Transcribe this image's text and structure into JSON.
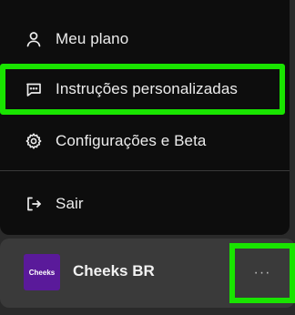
{
  "menu": {
    "items": [
      {
        "label": "Meu plano",
        "icon": "user-icon"
      },
      {
        "label": "Instruções personalizadas",
        "icon": "message-square-icon"
      },
      {
        "label": "Configurações e Beta",
        "icon": "gear-icon"
      },
      {
        "label": "Sair",
        "icon": "logout-icon"
      }
    ]
  },
  "profile": {
    "avatar_text": "Cheeks",
    "name": "Cheeks BR",
    "more_label": "···"
  },
  "colors": {
    "menu_bg": "#0d0d0d",
    "profile_bg": "#3a3a3a",
    "avatar_bg": "#5a1a9a",
    "highlight": "#19e400",
    "text": "#ececec"
  }
}
